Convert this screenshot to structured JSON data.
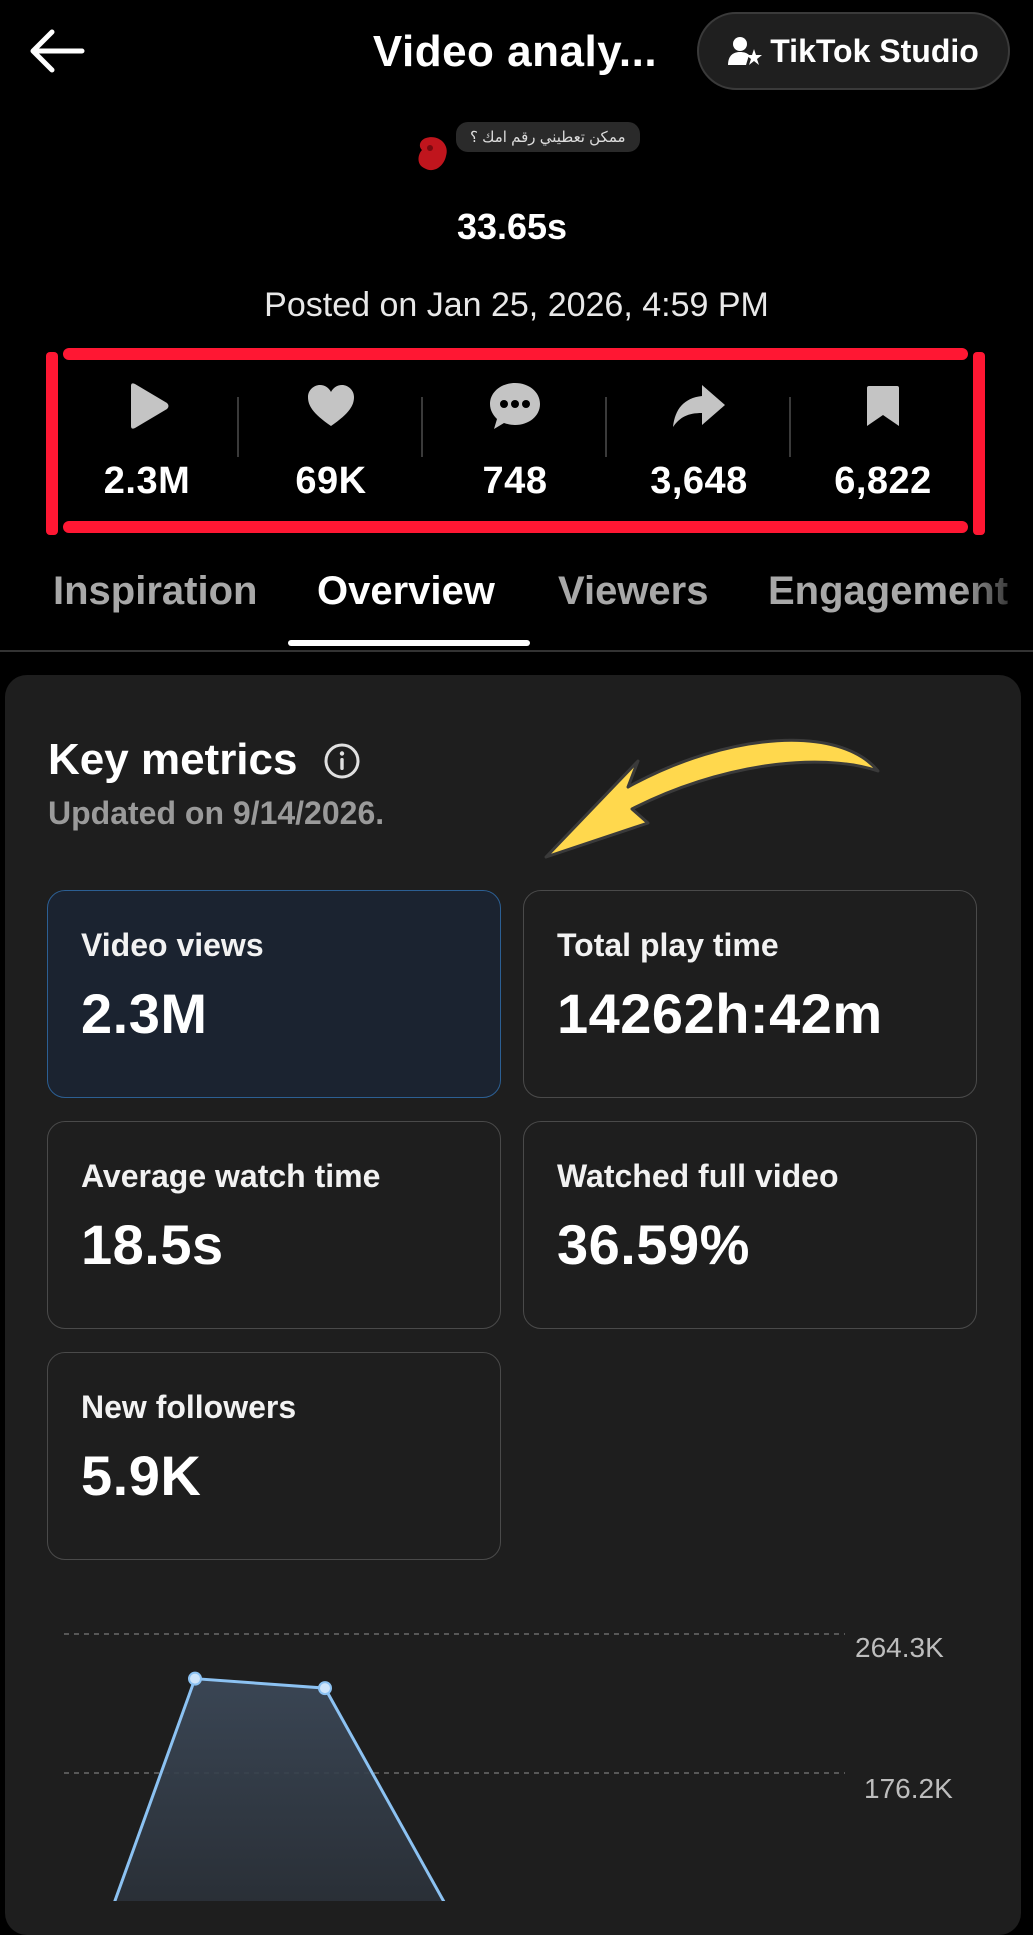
{
  "header": {
    "title": "Video analy...",
    "studio_button": "TikTok Studio"
  },
  "video": {
    "caption": "ممكن تعطيني رقم امك ؟",
    "duration": "33.65s",
    "posted": "Posted on Jan 25, 2026, 4:59 PM"
  },
  "stats": [
    {
      "icon": "play-icon",
      "value": "2.3M"
    },
    {
      "icon": "heart-icon",
      "value": "69K"
    },
    {
      "icon": "comment-icon",
      "value": "748"
    },
    {
      "icon": "share-icon",
      "value": "3,648"
    },
    {
      "icon": "bookmark-icon",
      "value": "6,822"
    }
  ],
  "tabs": [
    {
      "label": "Inspiration",
      "active": false
    },
    {
      "label": "Overview",
      "active": true
    },
    {
      "label": "Viewers",
      "active": false
    },
    {
      "label": "Engagement",
      "active": false
    }
  ],
  "key_metrics": {
    "title": "Key metrics",
    "updated": "Updated on 9/14/2026.",
    "cards": [
      {
        "label": "Video views",
        "value": "2.3M",
        "selected": true
      },
      {
        "label": "Total play time",
        "value": "14262h:42m",
        "selected": false
      },
      {
        "label": "Average watch time",
        "value": "18.5s",
        "selected": false
      },
      {
        "label": "Watched full video",
        "value": "36.59%",
        "selected": false
      },
      {
        "label": "New followers",
        "value": "5.9K",
        "selected": false
      }
    ]
  },
  "colors": {
    "highlight": "#ff1733",
    "arrow": "#ffd84d",
    "chart_line": "#8cc2f2",
    "selected_card_border": "#2c5f93"
  },
  "chart_data": {
    "type": "area",
    "y_tick_labels": [
      "264.3K",
      "176.2K"
    ],
    "y_ticks": [
      264300,
      176200
    ],
    "ylim": [
      0,
      264300
    ],
    "series": [
      {
        "values": [
          90000,
          236000,
          230000,
          90000
        ]
      }
    ]
  }
}
